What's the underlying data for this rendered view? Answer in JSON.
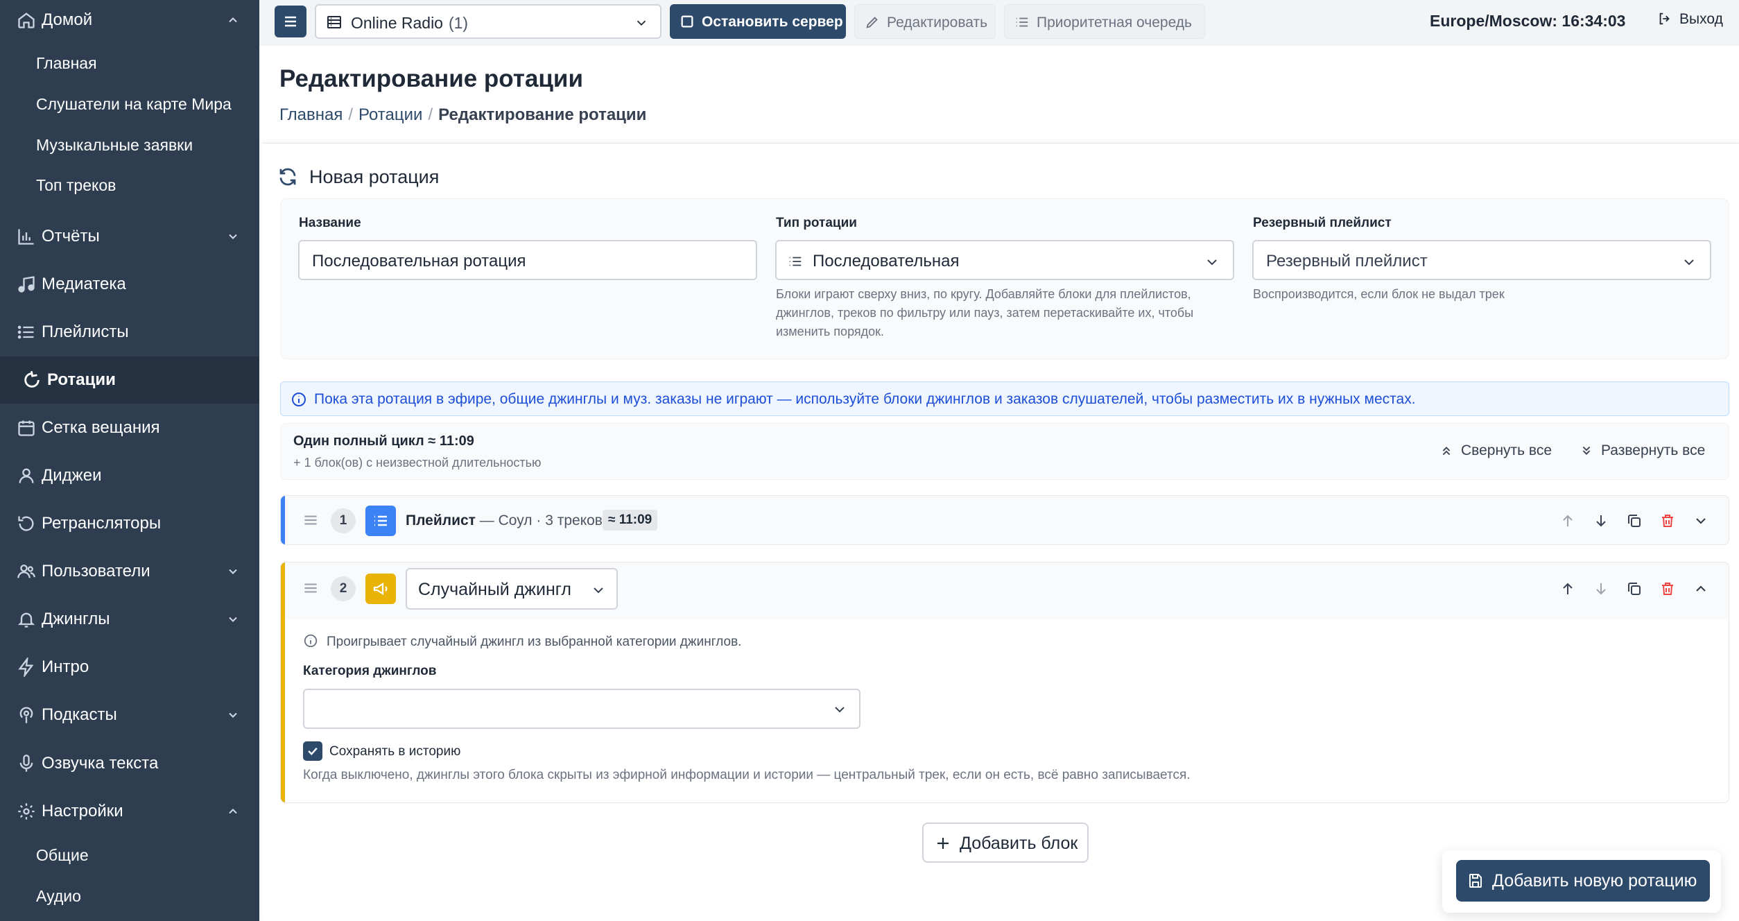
{
  "sidebar": {
    "home": {
      "label": "Домой",
      "children": [
        "Главная",
        "Слушатели на карте Мира",
        "Музыкальные заявки",
        "Топ треков"
      ]
    },
    "items": [
      {
        "label": "Отчёты",
        "icon": "chart-bars-icon",
        "expandable": true
      },
      {
        "label": "Медиатека",
        "icon": "music-note-icon",
        "expandable": false
      },
      {
        "label": "Плейлисты",
        "icon": "list-icon",
        "expandable": false
      },
      {
        "label": "Ротации",
        "icon": "rotate-icon",
        "expandable": false,
        "active": true
      },
      {
        "label": "Сетка вещания",
        "icon": "calendar-icon",
        "expandable": false
      },
      {
        "label": "Диджеи",
        "icon": "user-icon",
        "expandable": false
      },
      {
        "label": "Ретрансляторы",
        "icon": "relay-icon",
        "expandable": false
      },
      {
        "label": "Пользователи",
        "icon": "users-icon",
        "expandable": true
      },
      {
        "label": "Джинглы",
        "icon": "bell-icon",
        "expandable": true
      },
      {
        "label": "Интро",
        "icon": "bolt-icon",
        "expandable": false
      },
      {
        "label": "Подкасты",
        "icon": "podcast-icon",
        "expandable": true
      },
      {
        "label": "Озвучка текста",
        "icon": "microphone-icon",
        "expandable": false
      }
    ],
    "settings": {
      "label": "Настройки",
      "children": [
        "Общие",
        "Аудио"
      ]
    }
  },
  "topbar": {
    "station_name": "Online Radio",
    "station_count": "(1)",
    "stop_server": "Остановить сервер",
    "edit": "Редактировать",
    "priority_queue": "Приоритетная очередь",
    "clock": "Europe/Moscow: 16:34:03",
    "logout": "Выход"
  },
  "page": {
    "title": "Редактирование ротации",
    "breadcrumb": [
      "Главная",
      "Ротации",
      "Редактирование ротации"
    ]
  },
  "card": {
    "title": "Новая ротация",
    "form": {
      "name_label": "Название",
      "name_value": "Последовательная ротация",
      "type_label": "Тип ротации",
      "type_value": "Последовательная",
      "type_help": [
        "Блоки играют сверху вниз, по кругу. Добавляйте блоки для плейлистов,",
        "джинглов, треков по фильтру или пауз, затем перетаскивайте их, чтобы",
        "изменить порядок."
      ],
      "backup_label": "Резервный плейлист",
      "backup_placeholder": "Резервный плейлист",
      "backup_help": "Воспроизводится, если блок не выдал трек"
    },
    "alert": "Пока эта ротация в эфире, общие джинглы и муз. заказы не играют — используйте блоки джинглов и заказов слушателей, чтобы разместить их в нужных местах.",
    "cycle": {
      "title": "Один полный цикл ≈ 11:09",
      "subtitle": "+ 1 блок(ов) с неизвестной длительностью",
      "collapse_all": "Свернуть все",
      "expand_all": "Развернуть все"
    },
    "blocks": [
      {
        "number": "1",
        "type": "Плейлист",
        "description": " — Соул · 3 треков",
        "duration": "≈ 11:09",
        "accent": "#3b82f6"
      },
      {
        "number": "2",
        "type_select": "Случайный джингл",
        "accent": "#eab308",
        "info": "Проигрывает случайный джингл из выбранной категории джинглов.",
        "category_label": "Категория джинглов",
        "category_value": "",
        "save_history_label": "Сохранять в историю",
        "save_history_checked": true,
        "save_history_help": "Когда выключено, джинглы этого блока скрыты из эфирной информации и истории — центральный трек, если он есть, всё равно записывается."
      }
    ],
    "add_block": "Добавить блок",
    "add_rotation": "Добавить новую ротацию"
  },
  "colors": {
    "primary": "#2e4a6b",
    "sidebar": "#2e3e50",
    "danger": "#ef4444",
    "playlist": "#3b82f6",
    "jingle": "#eab308",
    "info": "#1d4ed8"
  }
}
